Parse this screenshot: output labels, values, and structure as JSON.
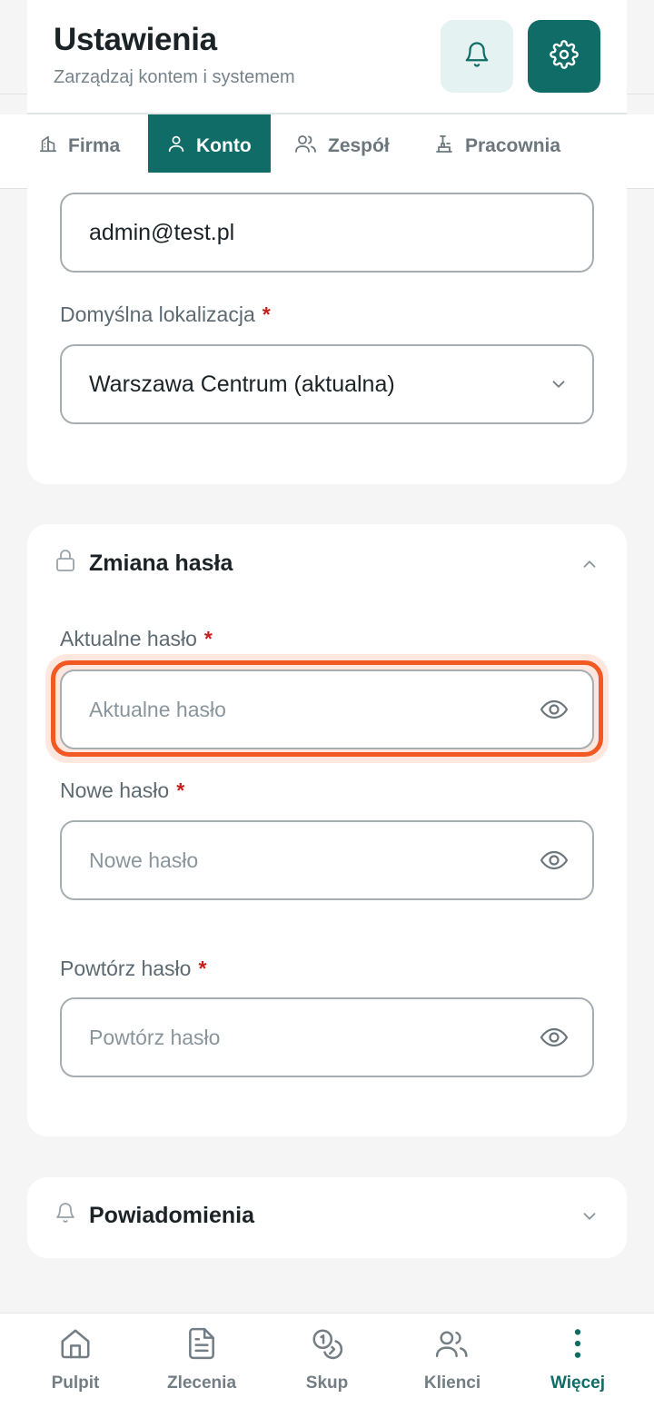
{
  "header": {
    "title": "Ustawienia",
    "subtitle": "Zarządzaj kontem i systemem",
    "bell_icon": "bell-icon",
    "settings_icon": "gear-icon"
  },
  "tabs": [
    {
      "label": "Firma",
      "icon": "building-icon",
      "active": false
    },
    {
      "label": "Konto",
      "icon": "user-icon",
      "active": true
    },
    {
      "label": "Zespół",
      "icon": "users-icon",
      "active": false
    },
    {
      "label": "Pracownia",
      "icon": "workshop-icon",
      "active": false
    }
  ],
  "account": {
    "email_value": "admin@test.pl",
    "location_label": "Domyślna lokalizacja",
    "location_value": "Warszawa Centrum (aktualna)"
  },
  "password": {
    "section_title": "Zmiana hasła",
    "current_label": "Aktualne hasło",
    "current_placeholder": "Aktualne hasło",
    "new_label": "Nowe hasło",
    "new_placeholder": "Nowe hasło",
    "repeat_label": "Powtórz hasło",
    "repeat_placeholder": "Powtórz hasło",
    "required_mark": "*"
  },
  "notifications": {
    "section_title": "Powiadomienia"
  },
  "bottom_nav": [
    {
      "label": "Pulpit",
      "icon": "home-icon",
      "active": false
    },
    {
      "label": "Zlecenia",
      "icon": "document-icon",
      "active": false
    },
    {
      "label": "Skup",
      "icon": "coins-icon",
      "active": false
    },
    {
      "label": "Klienci",
      "icon": "users-icon",
      "active": false
    },
    {
      "label": "Więcej",
      "icon": "more-vertical-icon",
      "active": true
    }
  ],
  "colors": {
    "brand": "#106c66",
    "focus": "#f35a23",
    "required": "#c4211c"
  }
}
